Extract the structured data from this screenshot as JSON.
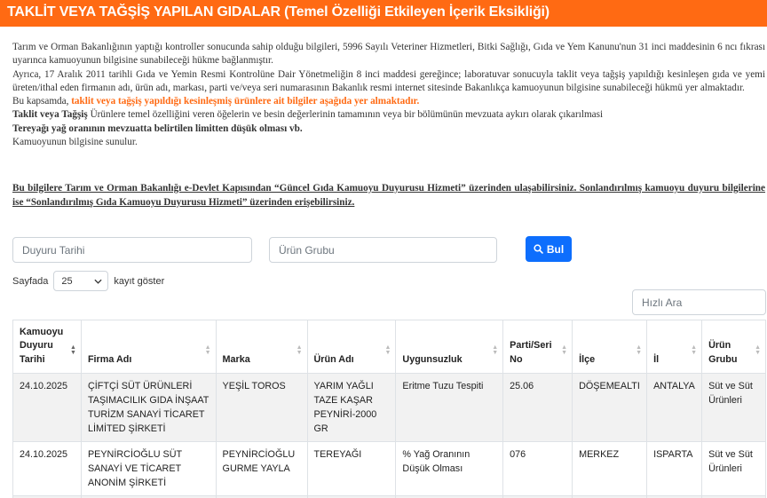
{
  "header": {
    "title": "TAKLİT VEYA TAĞŞİŞ YAPILAN GIDALAR (Temel Özelliği Etkileyen İçerik Eksikliği)"
  },
  "intro": {
    "p1": "Tarım ve Orman Bakanlığının yaptığı kontroller sonucunda sahip olduğu bilgileri, 5996 Sayılı Veteriner Hizmetleri, Bitki Sağlığı, Gıda ve Yem Kanunu'nun 31 inci maddesinin 6 ncı fıkrası uyarınca kamuoyunun bilgisine sunabileceği hükme bağlanmıştır.",
    "p2": "Ayrıca, 17 Aralık 2011 tarihli Gıda ve Yemin Resmi Kontrolüne Dair Yönetmeliğin 8 inci maddesi gereğince; laboratuvar sonucuyla taklit veya tağşiş yapıldığı kesinleşen gıda ve yemi üreten/ithal eden firmanın adı, ürün adı, markası, parti ve/veya seri numarasının Bakanlık resmi internet sitesinde Bakanlıkça kamuoyunun bilgisine sunabileceği hükmü yer almaktadır.",
    "p3_prefix": "Bu kapsamda, ",
    "p3_highlight": "taklit veya tağşiş yapıldığı kesinleşmiş ürünlere ait bilgiler aşağıda yer almaktadır.",
    "p4_bold": "Taklit veya Tağşiş",
    "p4_rest": " Ürünlere temel özelliğini veren öğelerin ve besin değerlerinin tamamının veya bir bölümünün mevzuata aykırı olarak çıkarılmasi",
    "p5": "Tereyağı yağ oranının mevzuatta belirtilen limitten düşük olması vb.",
    "p6": "Kamuoyunun bilgisine sunulur."
  },
  "link_note": "Bu bilgilere Tarım ve Orman Bakanlığı e-Devlet Kapısından “Güncel Gıda Kamuoyu Duyurusu Hizmeti” üzerinden ulaşabilirsiniz. Sonlandırılmış kamuoyu duyuru bilgilerine ise “Sonlandırılmış Gıda Kamuoyu Duyurusu Hizmeti” üzerinden erişebilirsiniz.",
  "filters": {
    "date_placeholder": "Duyuru Tarihi",
    "group_placeholder": "Ürün Grubu",
    "search_button": "Bul",
    "quick_search_placeholder": "Hızlı Ara"
  },
  "page_size": {
    "prefix": "Sayfada",
    "value": "25",
    "suffix": "kayıt göster"
  },
  "table": {
    "headers": [
      "Kamuoyu Duyuru Tarihi",
      "Firma Adı",
      "Marka",
      "Ürün Adı",
      "Uygunsuzluk",
      "Parti/Seri No",
      "İlçe",
      "İl",
      "Ürün Grubu"
    ],
    "rows": [
      [
        "24.10.2025",
        "ÇİFTÇİ SÜT ÜRÜNLERİ TAŞIMACILIK GIDA İNŞAAT TURİZM SANAYİ TİCARET LİMİTED ŞİRKETİ",
        "YEŞİL TOROS",
        "YARIM YAĞLI TAZE KAŞAR PEYNİRİ-2000 GR",
        "Eritme Tuzu Tespiti",
        "25.06",
        "DÖŞEMEALTI",
        "ANTALYA",
        "Süt ve Süt Ürünleri"
      ],
      [
        "24.10.2025",
        "PEYNİRCİOĞLU SÜT SANAYİ VE TİCARET ANONİM ŞİRKETİ",
        "PEYNİRCİOĞLU GURME YAYLA",
        "TEREYAĞI",
        "% Yağ Oranının Düşük Olması",
        "076",
        "MERKEZ",
        "ISPARTA",
        "Süt ve Süt Ürünleri"
      ],
      [
        "",
        "",
        "",
        "",
        "",
        "",
        "",
        "",
        ""
      ]
    ]
  },
  "icons": {
    "search": "search-icon",
    "dropdown": "chevron-down-icon",
    "sort": "sort-icon"
  },
  "colors": {
    "header_bg": "#ff6a13",
    "highlight": "#ff6a13",
    "button_bg": "#0d6efd",
    "row_stripe": "#f2f2f2"
  }
}
